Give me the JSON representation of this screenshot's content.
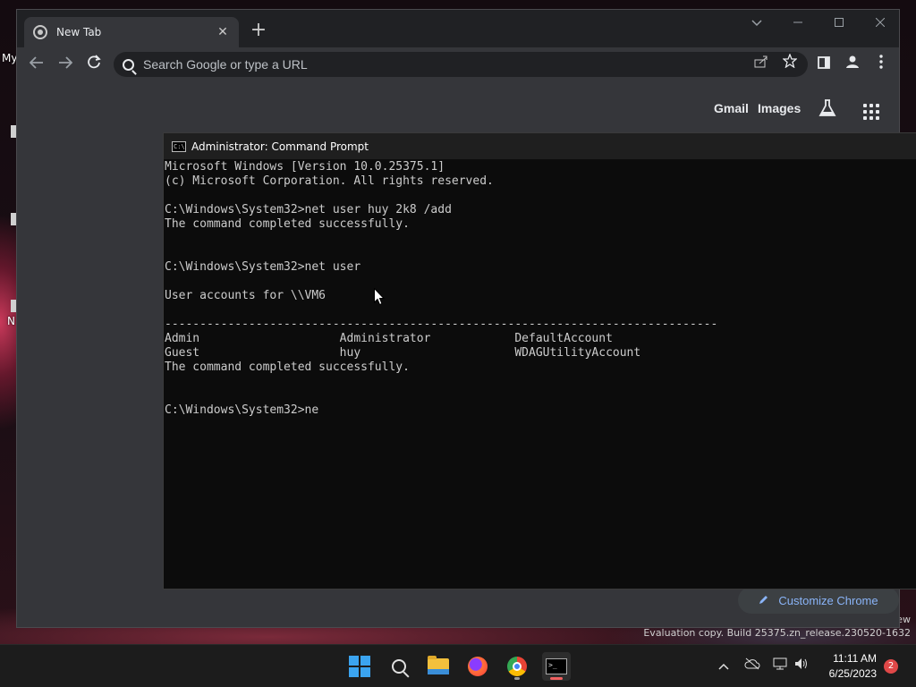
{
  "desktop": {
    "label_my": "My",
    "label_n": "N",
    "watermark": "Evaluation copy. Build 25375.zn_release.230520-1632",
    "watermark_partial": "ew"
  },
  "browser": {
    "tab_title": "New Tab",
    "tab_close": "✕",
    "new_tab": "+",
    "omnibox_placeholder": "Search Google or type a URL",
    "links": {
      "gmail": "Gmail",
      "images": "Images"
    },
    "customize_label": "Customize Chrome"
  },
  "cmd": {
    "title": "Administrator: Command Prompt",
    "lines": [
      "Microsoft Windows [Version 10.0.25375.1]",
      "(c) Microsoft Corporation. All rights reserved.",
      "",
      "C:\\Windows\\System32>net user huy 2k8 /add",
      "The command completed successfully.",
      "",
      "",
      "C:\\Windows\\System32>net user",
      "",
      "User accounts for \\\\VM6",
      "",
      "-------------------------------------------------------------------------------",
      "Admin                    Administrator            DefaultAccount",
      "Guest                    huy                      WDAGUtilityAccount",
      "The command completed successfully.",
      "",
      "",
      "C:\\Windows\\System32>ne"
    ]
  },
  "taskbar": {
    "time": "11:11 AM",
    "date": "6/25/2023",
    "notification_count": "2"
  },
  "icons": {
    "back": "back-arrow-icon",
    "forward": "forward-arrow-icon",
    "reload": "reload-icon",
    "share": "share-icon",
    "star": "bookmark-star-icon",
    "labs": "labs-flask-icon",
    "apps": "apps-grid-icon"
  }
}
